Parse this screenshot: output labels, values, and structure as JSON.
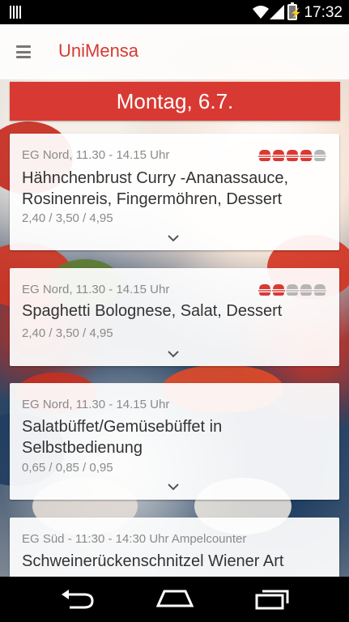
{
  "status_bar": {
    "time": "17:32",
    "battery_label": "⚡"
  },
  "app": {
    "title": "UniMensa"
  },
  "day": {
    "label": "Montag, 6.7."
  },
  "colors": {
    "accent": "#d83a33"
  },
  "meals": [
    {
      "location": "EG Nord, 11.30 - 14.15 Uhr",
      "name": "Hähnchenbrust Curry -Ananassauce, Rosinenreis, Fingermöhren, Dessert",
      "prices": "2,40 / 3,50 / 4,95",
      "rating": 4,
      "rating_max": 5
    },
    {
      "location": "EG Nord, 11.30 - 14.15 Uhr",
      "name": "Spaghetti Bolognese, Salat, Dessert",
      "prices": "2,40 / 3,50 / 4,95",
      "rating": 2,
      "rating_max": 5
    },
    {
      "location": "EG Nord, 11.30 - 14.15 Uhr",
      "name": "Salatbüffet/Gemüsebüffet in Selbstbedienung",
      "prices": "0,65 / 0,85 / 0,95"
    },
    {
      "location": "EG Süd - 11:30 - 14:30 Uhr Ampelcounter",
      "name": "Schweinerückenschnitzel Wiener Art"
    }
  ],
  "icons": {
    "menu": "hamburger-menu-icon",
    "expand": "chevron-down-icon",
    "rating": "burger-rating-icon",
    "back": "back-icon",
    "home": "home-icon",
    "recents": "recents-icon"
  }
}
